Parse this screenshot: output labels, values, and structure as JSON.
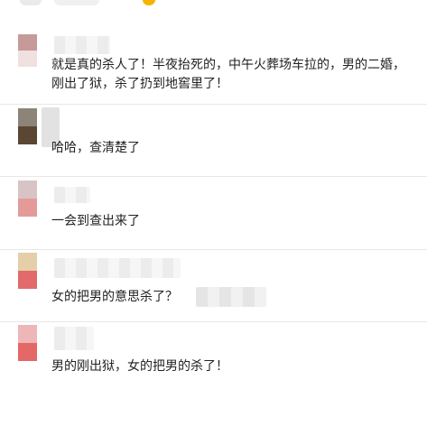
{
  "comments": [
    {
      "lines": [
        "就是真的杀人了！半夜抬死的，中午火葬场车拉的，男的二婚，",
        "刚出了狱，杀了扔到地窖里了！"
      ],
      "avatar_colors": [
        "#c79a9a",
        "#f0e0e0"
      ]
    },
    {
      "lines": [
        "哈哈，查清楚了"
      ],
      "avatar_colors": [
        "#8c8477",
        "#5a4632"
      ]
    },
    {
      "lines": [
        "一会到查出来了"
      ],
      "avatar_colors": [
        "#d8c4c4",
        "#e59a9a"
      ]
    },
    {
      "lines": [
        "女的把男的意思杀了？"
      ],
      "avatar_colors": [
        "#e4cfa8",
        "#e36a6a"
      ]
    },
    {
      "lines": [
        "男的刚出狱，女的把男的杀了！"
      ],
      "avatar_colors": [
        "#eeb6b6",
        "#e46868"
      ]
    }
  ]
}
